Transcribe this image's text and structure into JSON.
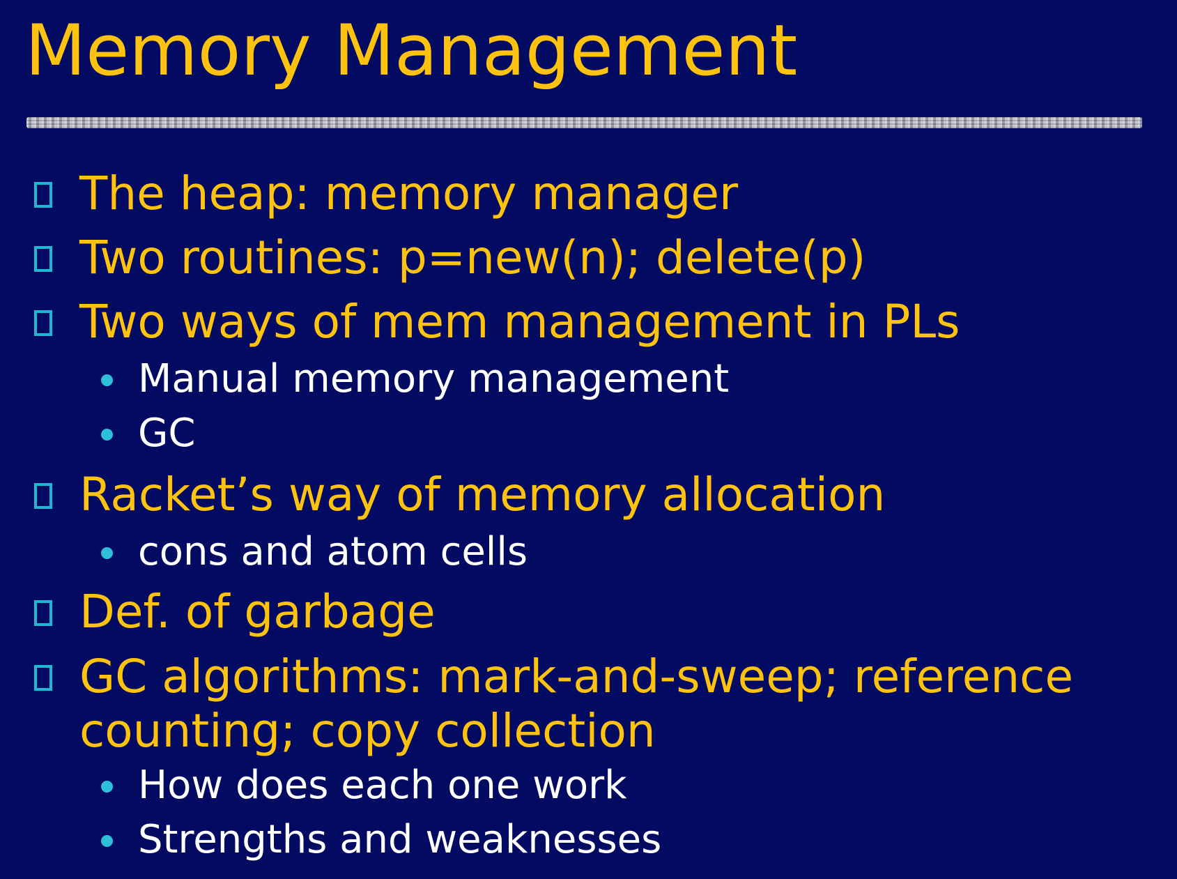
{
  "slide": {
    "title": "Memory Management",
    "bullets": [
      {
        "text": "The heap: memory manager"
      },
      {
        "text": "Two routines: p=new(n); delete(p)"
      },
      {
        "text": "Two ways of mem management in PLs",
        "sub": [
          "Manual memory management",
          "GC"
        ]
      },
      {
        "text": "Racket’s way of memory allocation",
        "sub": [
          "cons and atom cells"
        ]
      },
      {
        "text": "Def. of garbage"
      },
      {
        "text": "GC algorithms: mark-and-sweep; reference",
        "continuation": "counting; copy collection",
        "sub": [
          "How does each one work",
          "Strengths and weaknesses"
        ]
      }
    ]
  },
  "colors": {
    "background": "#020a62",
    "title": "#ffc20f",
    "level1_text": "#ffc20f",
    "level2_text": "#ffffff",
    "bullet_marker": "#1fb7d3"
  }
}
